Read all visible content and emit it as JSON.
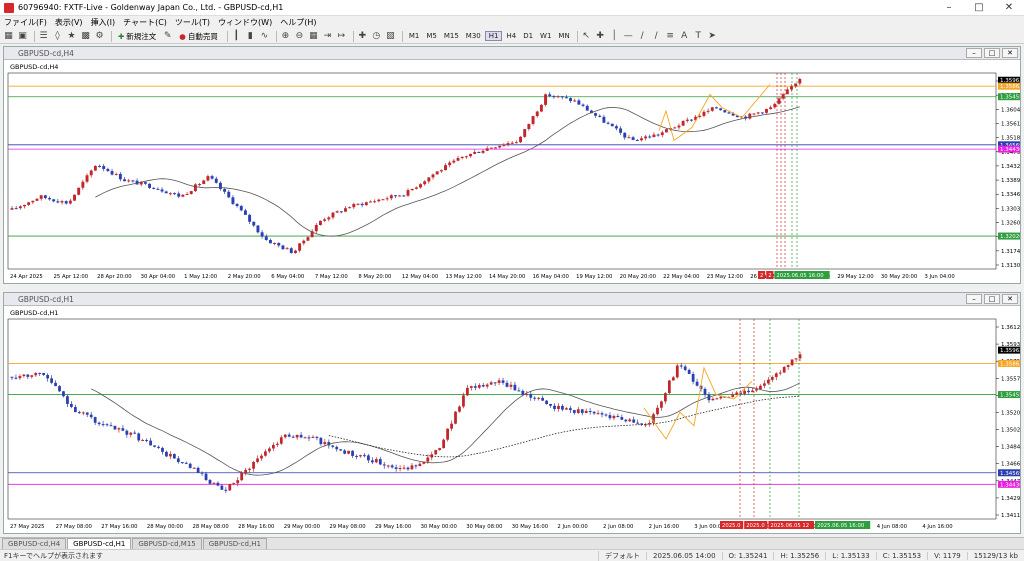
{
  "window": {
    "title": "60796940: FXTF-Live - Goldenway Japan Co., Ltd. - GBPUSD-cd,H1"
  },
  "menu": [
    "ファイル(F)",
    "表示(V)",
    "挿入(I)",
    "チャート(C)",
    "ツール(T)",
    "ウィンドウ(W)",
    "ヘルプ(H)"
  ],
  "toolbar": {
    "new_order": "新規注文",
    "auto_trading": "自動売買",
    "timeframes": [
      "M1",
      "M5",
      "M15",
      "M30",
      "H1",
      "H4",
      "D1",
      "W1",
      "MN"
    ],
    "active_timeframe": "H1"
  },
  "charts": [
    {
      "window_title": "GBPUSD-cd,H4",
      "label": "GBPUSD-cd,H4",
      "price_labels": [
        "1.36900",
        "1.36470",
        "1.36040",
        "1.35610",
        "1.35180",
        "1.34750",
        "1.34320",
        "1.33890",
        "1.33460",
        "1.33030",
        "1.32600",
        "1.32170",
        "1.31740",
        "1.31300"
      ],
      "level_tags": [
        {
          "text": "1.35962",
          "color": "#000000",
          "price": 1.3683
        },
        {
          "text": "1.35863",
          "color": "#f5a623",
          "price": 1.3665
        },
        {
          "text": "1.35455",
          "color": "#2e9e3e",
          "price": 1.3633
        },
        {
          "text": "1.34569",
          "color": "#2b3fb0",
          "price": 1.3487
        },
        {
          "text": "1.34436",
          "color": "#e91ee0",
          "price": 1.3474
        },
        {
          "text": "1.32026",
          "color": "#2e9e3e",
          "price": 1.321
        }
      ],
      "time_labels": [
        "24 Apr 2025",
        "25 Apr 12:00",
        "28 Apr 20:00",
        "30 Apr 04:00",
        "1 May 12:00",
        "2 May 20:00",
        "6 May 04:00",
        "7 May 12:00",
        "8 May 20:00",
        "12 May 04:00",
        "13 May 12:00",
        "14 May 20:00",
        "16 May 04:00",
        "19 May 12:00",
        "20 May 20:00",
        "22 May 04:00",
        "23 May 12:00",
        "26 May 20:00",
        "28 May 04:00",
        "29 May 12:00",
        "30 May 20:00",
        "3 Jun 04:00"
      ],
      "time_tags": [
        "2",
        "2",
        "2025.06.05 16:00"
      ]
    },
    {
      "window_title": "GBPUSD-cd,H1",
      "label": "GBPUSD-cd,H1",
      "price_labels": [
        "1.36120",
        "1.35935",
        "1.35755",
        "1.35570",
        "1.35390",
        "1.35205",
        "1.35025",
        "1.34840",
        "1.34660",
        "1.34475",
        "1.34295",
        "1.34115"
      ],
      "level_tags": [
        {
          "text": "1.35962",
          "color": "#000000",
          "price": 1.3595
        },
        {
          "text": "1.35863",
          "color": "#f5a623",
          "price": 1.358
        },
        {
          "text": "1.35455",
          "color": "#2e9e3e",
          "price": 1.3545
        },
        {
          "text": "1.34569",
          "color": "#2b3fb0",
          "price": 1.3457
        },
        {
          "text": "1.34436",
          "color": "#e91ee0",
          "price": 1.3444
        }
      ],
      "time_labels": [
        "27 May 2025",
        "27 May 08:00",
        "27 May 16:00",
        "28 May 00:00",
        "28 May 08:00",
        "28 May 16:00",
        "29 May 00:00",
        "29 May 08:00",
        "29 May 16:00",
        "30 May 00:00",
        "30 May 08:00",
        "30 May 16:00",
        "2 Jun 00:00",
        "2 Jun 08:00",
        "2 Jun 16:00",
        "3 Jun 00:00",
        "3 Jun 08:00",
        "3 Jun 16:00",
        "4 Jun 00:00",
        "4 Jun 08:00",
        "4 Jun 16:00"
      ],
      "time_tags": [
        "2025.0",
        "2025.0",
        "2025.06.05 12",
        "2025.06.05 16:00"
      ]
    }
  ],
  "tabs": [
    {
      "label": "GBPUSD-cd,H4",
      "active": false
    },
    {
      "label": "GBPUSD-cd,H1",
      "active": true
    },
    {
      "label": "GBPUSD-cd,M15",
      "active": false
    },
    {
      "label": "GBPUSD-cd,H1",
      "active": false
    }
  ],
  "status": {
    "help": "F1キーでヘルプが表示されます",
    "profile": "デフォルト",
    "datetime": "2025.06.05 14:00",
    "open": "O: 1.35241",
    "high": "H: 1.35256",
    "low": "L: 1.35133",
    "close": "C: 1.35153",
    "volume": "V: 1179",
    "traffic": "15129/13 kb"
  },
  "colors": {
    "bull": "#c0272d",
    "bear": "#2b3fb0",
    "ma_fast": "#555555",
    "ma_slow": "#222222"
  }
}
